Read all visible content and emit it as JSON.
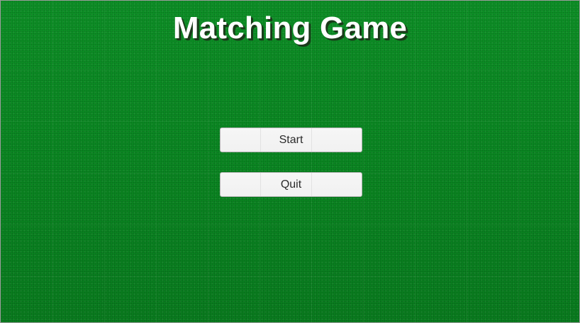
{
  "title": "Matching Game",
  "menu": {
    "start_label": "Start",
    "quit_label": "Quit"
  },
  "colors": {
    "felt_green": "#0a8c22",
    "button_bg": "#f4f4f4",
    "title_text": "#ffffff"
  }
}
